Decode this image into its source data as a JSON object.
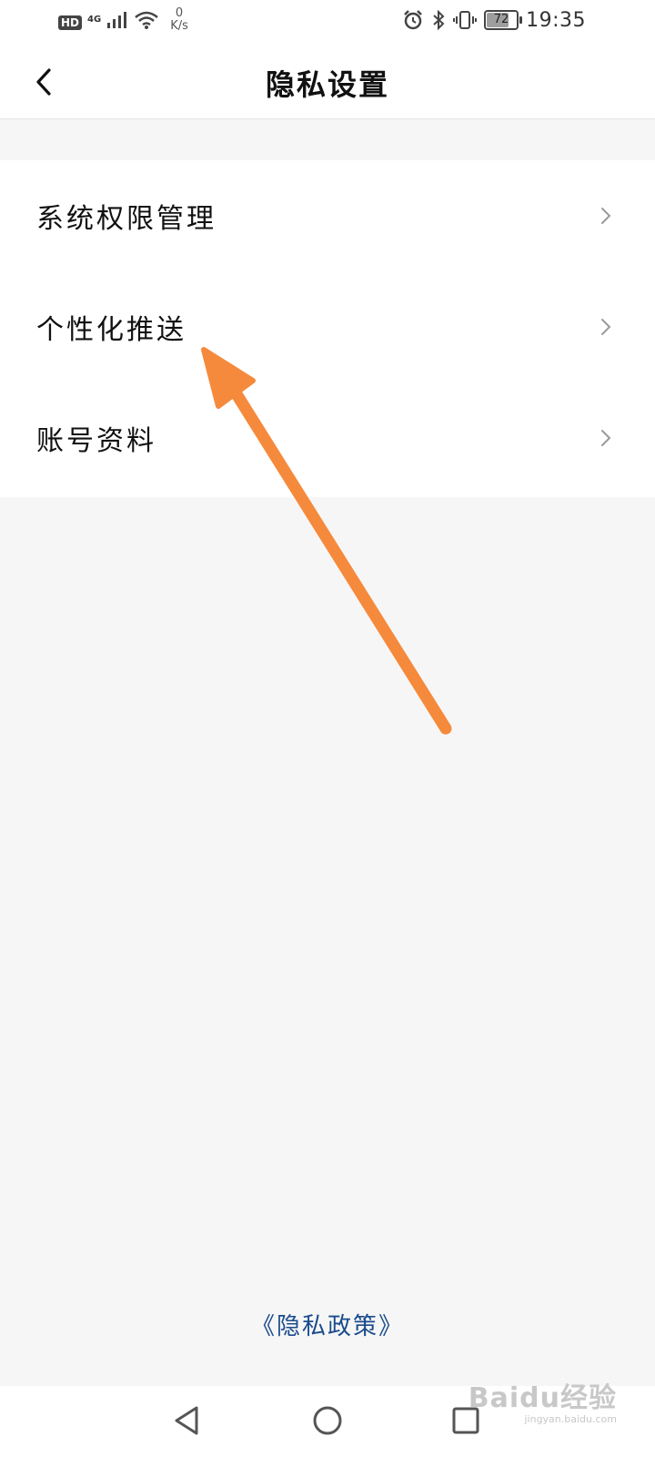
{
  "status_bar": {
    "hd_badge": "HD",
    "network": "4G",
    "speed_value": "0",
    "speed_unit": "K/s",
    "battery_level": "72",
    "time": "19:35",
    "icons": [
      "signal-icon",
      "wifi-icon",
      "alarm-icon",
      "bluetooth-icon",
      "vibrate-icon",
      "battery-icon"
    ]
  },
  "header": {
    "title": "隐私设置",
    "back_icon": "chevron-left-icon"
  },
  "menu": {
    "items": [
      {
        "label": "系统权限管理",
        "icon": "chevron-right-icon"
      },
      {
        "label": "个性化推送",
        "icon": "chevron-right-icon"
      },
      {
        "label": "账号资料",
        "icon": "chevron-right-icon"
      }
    ]
  },
  "footer": {
    "policy_link": "《隐私政策》"
  },
  "system_nav": {
    "buttons": [
      "back-triangle-icon",
      "home-circle-icon",
      "recents-square-icon"
    ]
  },
  "watermark": {
    "title": "Baidu经验",
    "url": "jingyan.baidu.com"
  },
  "colors": {
    "background": "#f6f6f6",
    "panel": "#ffffff",
    "link": "#1a4b8c",
    "annotation_arrow": "#f58a3c"
  }
}
